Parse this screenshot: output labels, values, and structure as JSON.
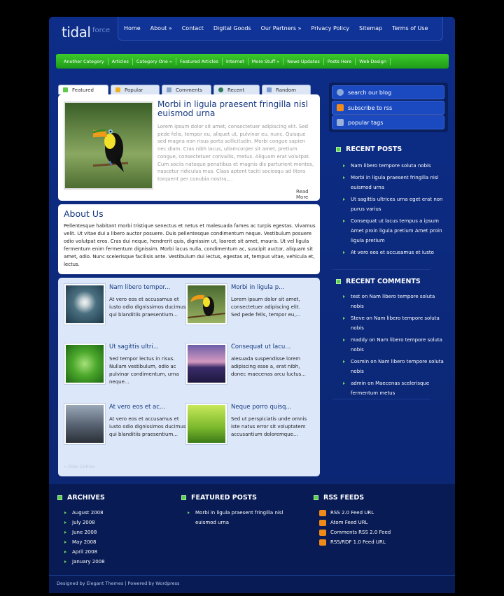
{
  "logo": {
    "main": "tidal",
    "sub": "force"
  },
  "topnav": [
    "Home",
    "About »",
    "Contact",
    "Digital Goods",
    "Our Partners »",
    "Privacy Policy",
    "Sitemap",
    "Terms of Use"
  ],
  "catnav": [
    "Another Category",
    "Articles",
    "Category One »",
    "Featured Articles",
    "Internet",
    "More Stuff »",
    "News Updates",
    "Posts Here",
    "Web Design"
  ],
  "tabs": [
    {
      "label": "Featured",
      "icon": "leaf-icon"
    },
    {
      "label": "Popular",
      "icon": "chart-icon"
    },
    {
      "label": "Comments",
      "icon": "people-icon"
    },
    {
      "label": "Recent",
      "icon": "globe-icon"
    },
    {
      "label": "Random",
      "icon": "funnel-icon"
    }
  ],
  "featured": {
    "title": "Morbi in ligula praesent fringilla nisl euismod urna",
    "text": "Lorem ipsum dolor sit amet, consectetuer adipiscing elit. Sed pede felis, tempor eu, aliquet ut, pulvinar eu, nunc. Quisque sed magna non risus porta sollicitudin. Morbi congue sapien nec diam. Cras nibh lacus, ullamcorper sit amet, pretium congue, consectetuer convallis, metus. Aliquam erat volutpat. Cum sociis natoque penatibus et magnis dis parturient montes, nascetur ridiculus mus. Class aptent taciti sociosqu ad litora torquent per conubia nostra,...",
    "read_more": "Read More"
  },
  "about": {
    "title": "About Us",
    "text": "Pellentesque habitant morbi tristique senectus et netus et malesuada fames ac turpis egestas. Vivamus velit. Ut vitae dui a libero auctor posuere. Duis pellentesque condimentum neque. Vestibulum posuere odio volutpat eros. Cras dui neque, hendrerit quis, dignissim ut, laoreet sit amet, mauris. Ut vel ligula fermentum enim fermentum dignissim. Morbi lacus nulla, condimentum ac, suscipit auctor, aliquam sit amet, odio. Nunc scelerisque facilisis ante. Vestibulum dui lectus, egestas at, tempus vitae, vehicula et, lectus."
  },
  "posts": [
    {
      "title": "Nam libero tempor...",
      "text": "At vero eos et accusamus et iusto odio dignissimos ducimus qui blanditiis praesentium..."
    },
    {
      "title": "Morbi in ligula p...",
      "text": "Lorem ipsum dolor sit amet, consectetuer adipiscing elit. Sed pede felis, tempor eu,..."
    },
    {
      "title": "Ut sagittis ultri...",
      "text": "Sed tempor lectus in risus. Nullam vestibulum, odio ac pulvinar condimentum, urna neque..."
    },
    {
      "title": "Consequat ut lacu...",
      "text": "alesuada suspendisse lorem adipiscing esse a, erat nibh, donec maecenas arcu luctus..."
    },
    {
      "title": "At vero eos et ac...",
      "text": "At vero eos et accusamus et iusto odio dignissimos ducimus qui blanditiis praesentium..."
    },
    {
      "title": "Neque porro quisq...",
      "text": "Sed ut perspiciatis unde omnis iste natus error sit voluptatem accusantium doloremque..."
    }
  ],
  "grid_footer": "« Older Entries",
  "side_buttons": [
    {
      "label": "search our blog",
      "icon": "search-icon"
    },
    {
      "label": "subscribe to rss",
      "icon": "rss-icon"
    },
    {
      "label": "popular tags",
      "icon": "tag-icon"
    }
  ],
  "recent_posts": {
    "heading": "RECENT POSTS",
    "items": [
      "Nam libero tempore soluta nobis",
      "Morbi in ligula praesent fringilla nisl euismod urna",
      "Ut sagittis ultrices urna eget erat non purus varius",
      "Consequat ut lacus tempus a ipsum Amet proin ligula pretium Amet proin ligula pretium",
      "At vero eos et accusamus et iusto"
    ]
  },
  "recent_comments": {
    "heading": "RECENT COMMENTS",
    "items": [
      "test on Nam libero tempore soluta nobis",
      "Steve on Nam libero tempore soluta nobis",
      "maddy on Nam libero tempore soluta nobis",
      "Cosmin on Nam libero tempore soluta nobis",
      "admin on Maecenas scelerisque fermentum metus"
    ]
  },
  "archives": {
    "heading": "ARCHIVES",
    "items": [
      "August 2008",
      "July 2008",
      "June 2008",
      "May 2008",
      "April 2008",
      "January 2008"
    ]
  },
  "featured_posts": {
    "heading": "FEATURED POSTS",
    "items": [
      "Morbi in ligula praesent fringilla nisl euismod urna"
    ]
  },
  "rss_feeds": {
    "heading": "RSS FEEDS",
    "items": [
      "RSS 2.0 Feed URL",
      "Atom Feed URL",
      "Comments RSS 2.0 Feed",
      "RSS/RDF 1.0 Feed URL"
    ]
  },
  "copyright": "Designed by Elegant Themes | Powered by Wordpress",
  "colors": {
    "background": "#000000",
    "page": "#0d2a7a",
    "catbar": "#2fb422",
    "title": "#14387f",
    "footer": "#081b54"
  }
}
